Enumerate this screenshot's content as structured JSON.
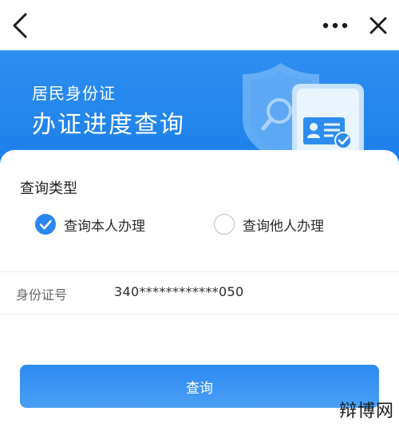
{
  "navbar": {
    "back_icon": "chevron-left-icon",
    "more_icon": "more-dots-icon",
    "close_icon": "close-icon"
  },
  "banner": {
    "subtitle": "居民身份证",
    "title": "办证进度查询",
    "illustration": "id-card-shield-illustration",
    "background_color": "#1f84ec"
  },
  "form": {
    "section_title": "查询类型",
    "query_type_options": [
      {
        "label": "查询本人办理",
        "checked": true
      },
      {
        "label": "查询他人办理",
        "checked": false
      }
    ],
    "id_field": {
      "label": "身份证号",
      "value": "340************050"
    },
    "submit_label": "查询",
    "accent_color": "#2b86ee"
  },
  "watermark": "辩博网"
}
